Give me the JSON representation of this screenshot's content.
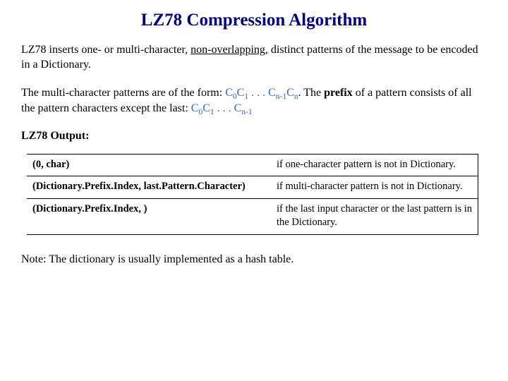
{
  "title": "LZ78 Compression Algorithm",
  "p1_a": "LZ78 inserts one- or multi-character, ",
  "p1_underline": "non-overlapping",
  "p1_b": ", distinct patterns of the message to be encoded in a Dictionary.",
  "p2_a": "The multi-character patterns are of the form: ",
  "p2_form_c0": "C",
  "p2_form_0": "0",
  "p2_form_c1": "C",
  "p2_form_1": "1",
  "p2_dots": " . . . ",
  "p2_form_cn1": "C",
  "p2_form_n1": "n-1",
  "p2_form_cn": "C",
  "p2_form_n": "n",
  "p2_period": ". ",
  "p2_the": "The ",
  "p2_prefix": "prefix",
  "p2_b": " of a pattern consists of all the pattern characters except the last:  ",
  "p2_form2_c0": "C",
  "p2_form2_0": "0",
  "p2_form2_c1": "C",
  "p2_form2_1": "1",
  "p2_dots2": " . . . ",
  "p2_form2_cn1": "C",
  "p2_form2_n1": "n-1",
  "output_label": "LZ78 Output:",
  "row1_left": "(0, char)",
  "row1_right": "if one-character pattern is not in Dictionary.",
  "row2_left": "(Dictionary.Prefix.Index, last.Pattern.Character)",
  "row2_right": "if multi-character pattern is not in Dictionary.",
  "row3_left": "(Dictionary.Prefix.Index,    )",
  "row3_right": "if the last input character or the last pattern is in the Dictionary.",
  "note": "Note: The dictionary is usually implemented as a hash table."
}
